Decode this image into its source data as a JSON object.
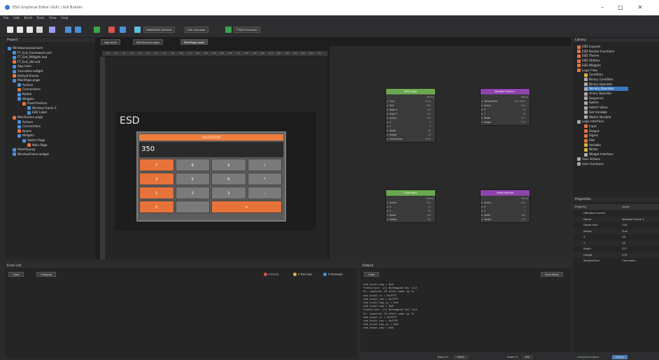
{
  "window": {
    "title": "ESD Graphical Editor (GUI) / GUI Builder",
    "min": "–",
    "max": "□",
    "close": "✕"
  },
  "menu": [
    "File",
    "Edit",
    "Build",
    "Tools",
    "View",
    "Help"
  ],
  "toolbar": {
    "select1": "EMBEDDED WIZARD",
    "select2": "ESD Simulator",
    "select3": "FT800 Simulator"
  },
  "project": {
    "title": "Project",
    "items": [
      {
        "label": "WindowsLayout.bxm",
        "indent": 0
      },
      {
        "label": "FT_Esd_Framework.esd",
        "indent": 1
      },
      {
        "label": "FT_Esd_Widgets.esd",
        "indent": 1
      },
      {
        "label": "FT_Esd_Util.esd",
        "indent": 1
      },
      {
        "label": "App.main",
        "indent": 1
      },
      {
        "label": "Calculator.widget",
        "indent": 1
      },
      {
        "label": "Default.theme",
        "indent": 1
      },
      {
        "label": "MainPage.page",
        "indent": 1
      },
      {
        "label": "Actions",
        "indent": 2
      },
      {
        "label": "Connections",
        "indent": 2
      },
      {
        "label": "Nodes",
        "indent": 2
      },
      {
        "label": "Widgets",
        "indent": 2
      },
      {
        "label": "Fixed Position",
        "indent": 3
      },
      {
        "label": "Window Frame 1",
        "indent": 4
      },
      {
        "label": "ESD Label",
        "indent": 4
      },
      {
        "label": "MainScreen.page",
        "indent": 1
      },
      {
        "label": "Actions",
        "indent": 2
      },
      {
        "label": "Connections",
        "indent": 2
      },
      {
        "label": "Nodes",
        "indent": 2
      },
      {
        "label": "Widgets",
        "indent": 2
      },
      {
        "label": "Switch Page",
        "indent": 3
      },
      {
        "label": "Main Page",
        "indent": 4
      },
      {
        "label": "Identity.png",
        "indent": 1
      },
      {
        "label": "WindowFrame.widget",
        "indent": 1
      }
    ]
  },
  "tabs": [
    "App.main",
    "MainScreen.page",
    "MainPage.page"
  ],
  "ruler_ticks": [
    "10",
    "20",
    "30",
    "40",
    "50",
    "60",
    "70",
    "80",
    "90",
    "100",
    "110",
    "120",
    "130",
    "140",
    "150",
    "160",
    "170",
    "180",
    "190",
    "200",
    "210",
    "220",
    "230",
    "240",
    "250",
    "260",
    "270"
  ],
  "design": {
    "esd_label": "ESD",
    "calc_title": "CALCULATOR",
    "display_value": "350",
    "keys": [
      [
        "7",
        "8",
        "9",
        "/"
      ],
      [
        "4",
        "5",
        "6",
        "*"
      ],
      [
        "1",
        "2",
        "3",
        "-"
      ],
      [
        "0",
        ".",
        "="
      ]
    ]
  },
  "nodes": {
    "esd_label": {
      "title": "ESD Label",
      "head_color": "#6aa84f",
      "rows": [
        [
          "Parent",
          ""
        ],
        [
          "Font",
          "Fixed"
        ],
        [
          "Text",
          "ESD"
        ],
        [
          "Align X",
          "Left"
        ],
        [
          "Align Y",
          "Top"
        ],
        [
          "Active",
          "True"
        ],
        [
          "X",
          "0"
        ],
        [
          "Y",
          "0"
        ],
        [
          "Width",
          "80"
        ],
        [
          "Height",
          "40"
        ],
        [
          "Auto Resize",
          "None"
        ]
      ]
    },
    "window_frame": {
      "title": "Window Frame 1",
      "head_color": "#8e44ad",
      "rows": [
        [
          "Parent",
          ""
        ],
        [
          "WindowTitle",
          "Calculator"
        ],
        [
          "Active",
          "True"
        ],
        [
          "X",
          "16"
        ],
        [
          "Y",
          "16"
        ],
        [
          "Width",
          "377"
        ],
        [
          "Height",
          "279"
        ]
      ]
    },
    "calculator": {
      "title": "Calculator",
      "head_color": "#6aa84f",
      "rows": [
        [
          "Parent",
          ""
        ],
        [
          "Active",
          "True"
        ],
        [
          "X",
          "10"
        ],
        [
          "Y",
          "30"
        ],
        [
          "Width",
          "200"
        ],
        [
          "Height",
          "160"
        ]
      ]
    },
    "fixed_position": {
      "title": "Fixed Position",
      "head_color": "#8e44ad",
      "rows": [
        [
          "Parent",
          ""
        ],
        [
          "Active",
          "True"
        ],
        [
          "X",
          "0"
        ],
        [
          "Y",
          "0"
        ],
        [
          "Width",
          "480"
        ],
        [
          "Height",
          "272"
        ]
      ]
    }
  },
  "errors": {
    "title": "Error List",
    "clear": "Clear",
    "collapse": "Collapse",
    "errors_label": "0 Errors",
    "warnings_label": "0 Warnings",
    "messages_label": "0 Messages"
  },
  "output": {
    "title": "Output",
    "clear": "Clear",
    "dropdown": "Simulation",
    "lines": [
      "cmd_touch_tag = 0x0",
      "Transcript: [1] Bitmapped Vec list",
      "Fn: register 15 after wake up fn",
      "cmd_touch_rz = 0x7FFF",
      "cmd_touch_raw = 0x7FFF",
      "cmd_touch_tag_xy = 0x0",
      "cmd_touch_tag = 0x0",
      "Transcript: [1] Bitmapped Vec list",
      "Fn: register 15 after wake up fn",
      "cmd_touch_rz = 0x7FFF",
      "cmd_touch_raw = 0x7FFF",
      "cmd_touch_tag_xy = 0x0",
      "cmd_touch_tag = 0x0"
    ]
  },
  "widgets": {
    "title": "Library",
    "items": [
      {
        "label": "ESD Layouts",
        "indent": 0,
        "color": "#e8733a"
      },
      {
        "label": "ESD Render Functions",
        "indent": 0,
        "color": "#e8733a"
      },
      {
        "label": "ESD Theme",
        "indent": 0,
        "color": "#e8733a"
      },
      {
        "label": "ESD Utilities",
        "indent": 0,
        "color": "#e8733a"
      },
      {
        "label": "ESD Widgets",
        "indent": 0,
        "color": "#e8733a"
      },
      {
        "label": "Logic Flow",
        "indent": 0,
        "color": "#e8733a"
      },
      {
        "label": "Condition",
        "indent": 1,
        "color": "#d4b23a"
      },
      {
        "label": "Binary Condition",
        "indent": 1,
        "color": "#aaaaaa"
      },
      {
        "label": "Binary Operator",
        "indent": 1,
        "color": "#aaaaaa"
      },
      {
        "label": "Ternary Operator",
        "indent": 1,
        "color": "#aaaaaa",
        "selected": true
      },
      {
        "label": "Unary Operator",
        "indent": 1,
        "color": "#aaaaaa"
      },
      {
        "label": "Sequence",
        "indent": 1,
        "color": "#aaaaaa"
      },
      {
        "label": "Switch",
        "indent": 1,
        "color": "#aaaaaa"
      },
      {
        "label": "Switch Value",
        "indent": 1,
        "color": "#aaaaaa"
      },
      {
        "label": "Get Variable",
        "indent": 1,
        "color": "#aaaaaa"
      },
      {
        "label": "Watch Variable",
        "indent": 1,
        "color": "#aaaaaa"
      },
      {
        "label": "Logic Interface",
        "indent": 0,
        "color": "#aaaaaa"
      },
      {
        "label": "Input",
        "indent": 1,
        "color": "#e8733a"
      },
      {
        "label": "Output",
        "indent": 1,
        "color": "#e8733a"
      },
      {
        "label": "Signal",
        "indent": 1,
        "color": "#e8733a"
      },
      {
        "label": "Slot",
        "indent": 1,
        "color": "#e8733a"
      },
      {
        "label": "Variable",
        "indent": 1,
        "color": "#d4b23a"
      },
      {
        "label": "Writer",
        "indent": 1,
        "color": "#d4b23a"
      },
      {
        "label": "Widget Interface",
        "indent": 1,
        "color": "#aaaaaa"
      },
      {
        "label": "User Actions",
        "indent": 0,
        "color": "#aaaaaa"
      },
      {
        "label": "User Functions",
        "indent": 0,
        "color": "#aaaaaa"
      }
    ]
  },
  "properties": {
    "title": "Properties",
    "col_property": "Property",
    "col_value": "Value",
    "rows": [
      [
        "(Window Frame)",
        ""
      ],
      [
        "Name",
        "Window Frame 1"
      ],
      [
        "Depth Sort",
        "128"
      ],
      [
        "Active",
        "True"
      ],
      [
        "X",
        "16"
      ],
      [
        "Y",
        "16"
      ],
      [
        "Width",
        "377"
      ],
      [
        "Height",
        "279"
      ],
      [
        "WindowTitle",
        "Calculator"
      ]
    ]
  },
  "status": {
    "zoom_a": "Zoom X:",
    "zoom_a_val": "100%",
    "zoom_b": "Zoom Y:",
    "zoom_b_val": "0%",
    "compiled": "Compiled status",
    "ready": "Ready"
  }
}
